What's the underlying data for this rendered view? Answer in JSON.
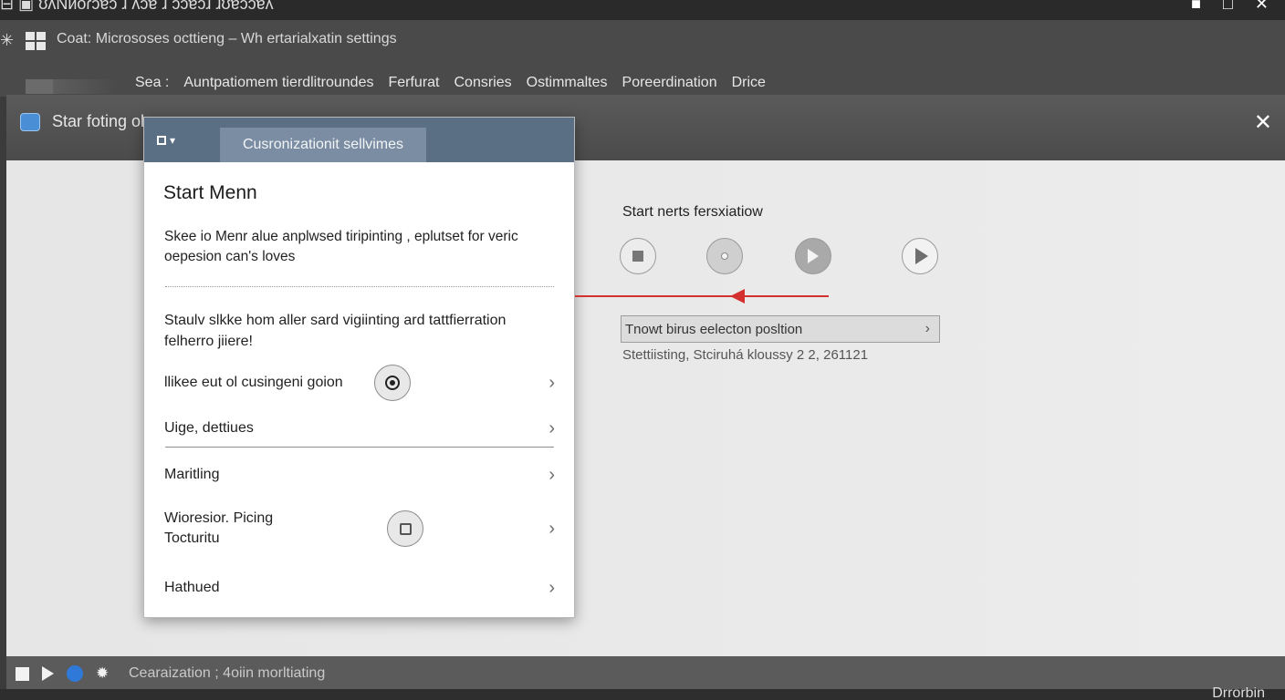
{
  "topbar": {
    "text": "⊟ ▣ ʊʌNᴎoɾɔɐɔ ɹ ʌɔɐ ɹ ɔɔɐɔɹ ɹʊɐɔɔɐʎ",
    "window_controls": [
      "■",
      "□",
      "✕"
    ]
  },
  "titlebar": {
    "title": "Coat: Micrososes octtieng – Wh ertarialxatin settings"
  },
  "menubar": {
    "items": [
      "Sea :",
      "Auntpatiomem tierdlitroundes",
      "Ferfurat",
      "Consries",
      "Ostimmaltes",
      "Poreerdination",
      "Drice"
    ]
  },
  "window": {
    "title": "Star foting ol",
    "close_label": "✕"
  },
  "panel": {
    "tab_label": "Cusronizationit sellvimes",
    "heading": "Start Menn",
    "description": "Skee io Menr alue anplwsed tiripinting , eplutset for veric oepesion can's loves",
    "description2": "Staulv slkke hom aller sard vigiinting ard tattfierration felherro jiiere!",
    "rows": [
      {
        "label": "llikee eut ol cusingeni goion"
      },
      {
        "label": "Uige, dettiues"
      },
      {
        "label": "Maritling"
      },
      {
        "label": "Wioresior. Picing Tocturitu"
      },
      {
        "label": "Hathued"
      }
    ]
  },
  "controls": {
    "title": "Start nerts fersxiatiow",
    "field_value": "Tnowt birus eelecton posltion",
    "meta": "Stettiisting, Stciruhá kloussy 2 2, 261121"
  },
  "statusbar": {
    "text": "Cearaization ; 4oiin morltiating"
  },
  "bottom": {
    "text": "Drrorbin"
  },
  "colors": {
    "accent": "#5b6f84",
    "arrow": "#d43030",
    "status_blue": "#2f79d8"
  }
}
